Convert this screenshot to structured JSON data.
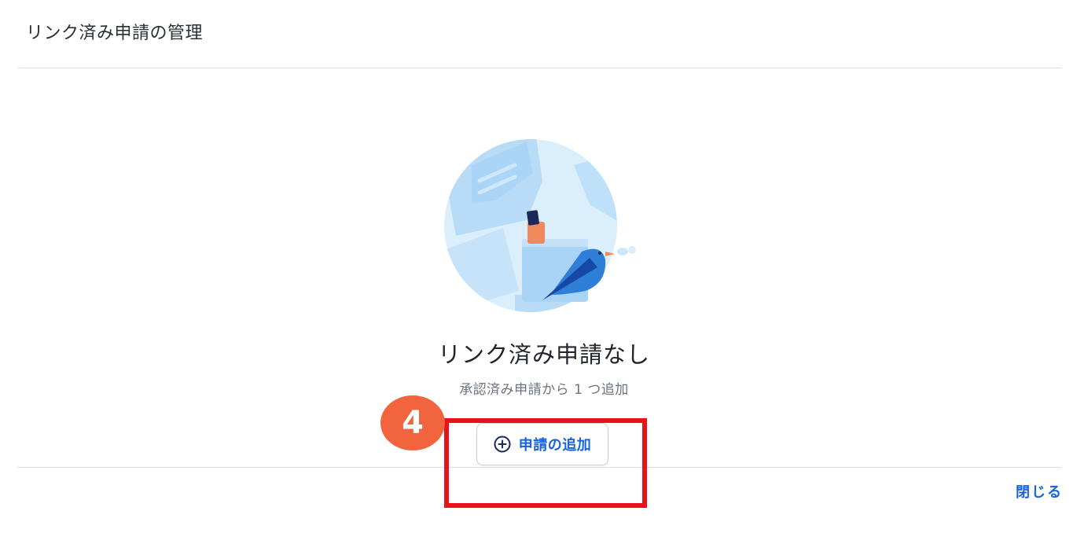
{
  "header": {
    "title": "リンク済み申請の管理"
  },
  "empty_state": {
    "illustration_icon": "bird-on-cup-illustration",
    "title": "リンク済み申請なし",
    "subtitle": "承認済み申請から 1 つ追加"
  },
  "actions": {
    "add_label": "申請の追加",
    "add_icon": "plus-circle-icon",
    "close_label": "閉じる"
  },
  "annotation": {
    "step_number": "4",
    "highlight_color": "#e8131a",
    "badge_color": "#f2643e"
  },
  "colors": {
    "accent": "#1565d8",
    "text_primary": "#22262c",
    "text_secondary": "#6b7380"
  }
}
